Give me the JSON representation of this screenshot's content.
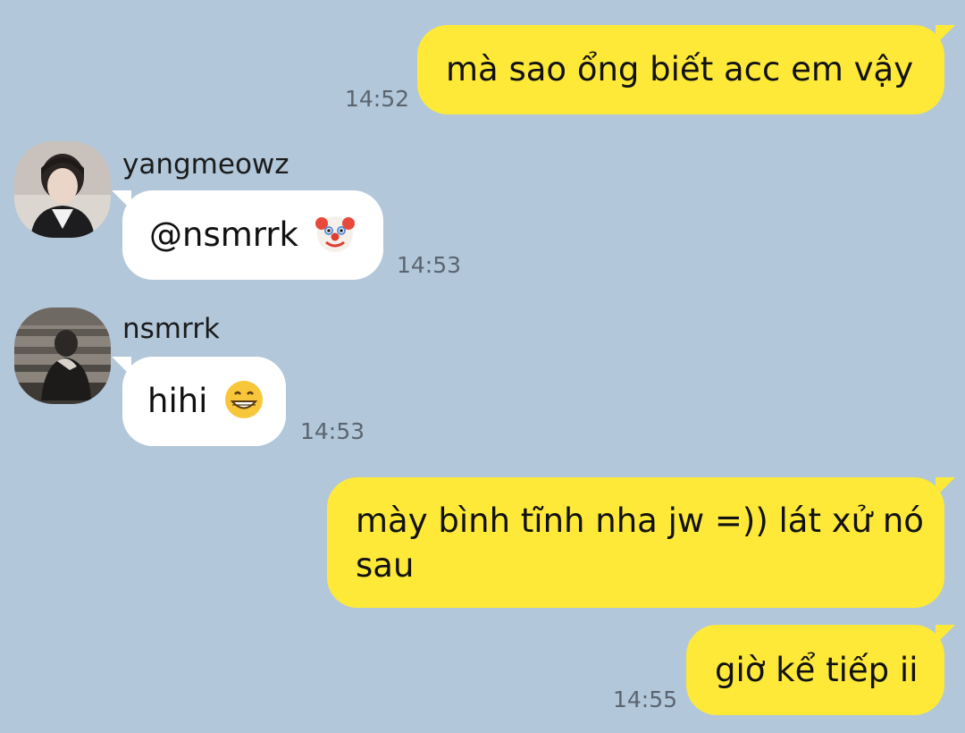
{
  "messages": [
    {
      "id": "m1",
      "direction": "outgoing",
      "text": "mà sao ổng biết acc em vậy",
      "time": "14:52"
    },
    {
      "id": "m2",
      "direction": "incoming",
      "sender": "yangmeowz",
      "text": "@nsmrrk",
      "emoji": "clown-face",
      "time": "14:53"
    },
    {
      "id": "m3",
      "direction": "incoming",
      "sender": "nsmrrk",
      "text": "hihi",
      "emoji": "grinning-face",
      "time": "14:53"
    },
    {
      "id": "m4",
      "direction": "outgoing",
      "text_line1": "mày bình tĩnh nha jw =)) lát xử nó",
      "text_line2": "sau"
    },
    {
      "id": "m5",
      "direction": "outgoing",
      "text": "giờ kể tiếp ii",
      "time": "14:55"
    }
  ],
  "colors": {
    "background": "#b2c7da",
    "outgoing_bubble": "#fee939",
    "incoming_bubble": "#ffffff",
    "timestamp": "#5b6570"
  }
}
